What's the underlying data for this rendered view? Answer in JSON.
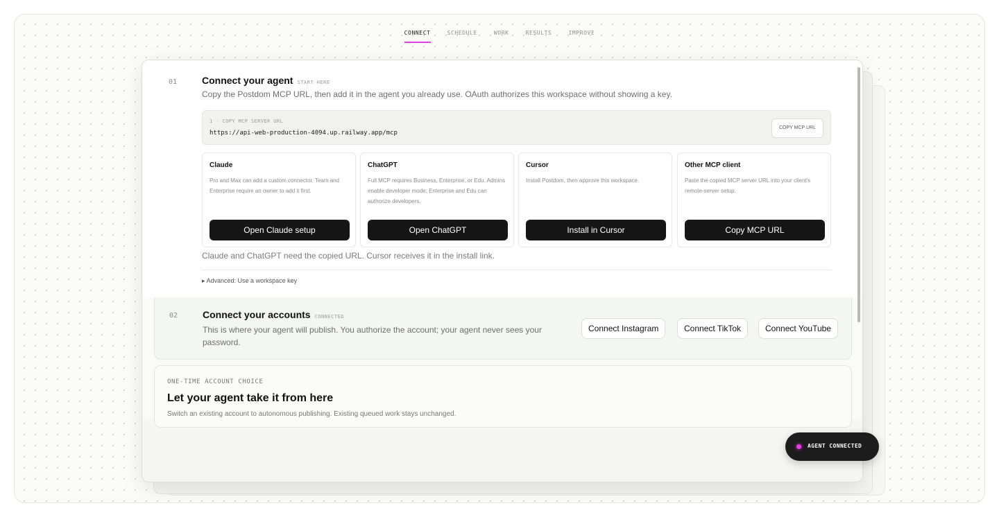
{
  "nav": {
    "tabs": [
      {
        "label": "CONNECT",
        "active": true
      },
      {
        "label": "SCHEDULE",
        "active": false
      },
      {
        "label": "WORK",
        "active": false
      },
      {
        "label": "RESULTS",
        "active": false
      },
      {
        "label": "IMPROVE",
        "active": false
      }
    ]
  },
  "step1": {
    "number": "01",
    "title": "Connect your agent",
    "tag": "START HERE",
    "description": "Copy the Postdom MCP URL, then add it in the agent you already use. OAuth authorizes this workspace without showing a key.",
    "url_label": "1 · COPY MCP SERVER URL",
    "url": "https://api-web-production-4094.up.railway.app/mcp",
    "copy_button": "COPY MCP URL",
    "cards": [
      {
        "title": "Claude",
        "desc": "Pro and Max can add a custom connector. Team and Enterprise require an owner to add it first.",
        "button": "Open Claude setup"
      },
      {
        "title": "ChatGPT",
        "desc": "Full MCP requires Business, Enterprise, or Edu. Admins enable developer mode; Enterprise and Edu can authorize developers.",
        "button": "Open ChatGPT"
      },
      {
        "title": "Cursor",
        "desc": "Install Postdom, then approve this workspace.",
        "button": "Install in Cursor"
      },
      {
        "title": "Other MCP client",
        "desc": "Paste the copied MCP server URL into your client's remote-server setup.",
        "button": "Copy MCP URL"
      }
    ],
    "note": "Claude and ChatGPT need the copied URL. Cursor receives it in the install link.",
    "advanced": "▸ Advanced: Use a workspace key"
  },
  "step2": {
    "number": "02",
    "title": "Connect your accounts",
    "tag": "CONNECTED",
    "description": "This is where your agent will publish. You authorize the account; your agent never sees your password.",
    "buttons": [
      "Connect Instagram",
      "Connect TikTok",
      "Connect YouTube"
    ]
  },
  "choice": {
    "kicker": "ONE-TIME ACCOUNT CHOICE",
    "title": "Let your agent take it from here",
    "description": "Switch an existing account to autonomous publishing. Existing queued work stays unchanged."
  },
  "status": {
    "label": "AGENT CONNECTED",
    "dot_color": "#e838e8"
  }
}
